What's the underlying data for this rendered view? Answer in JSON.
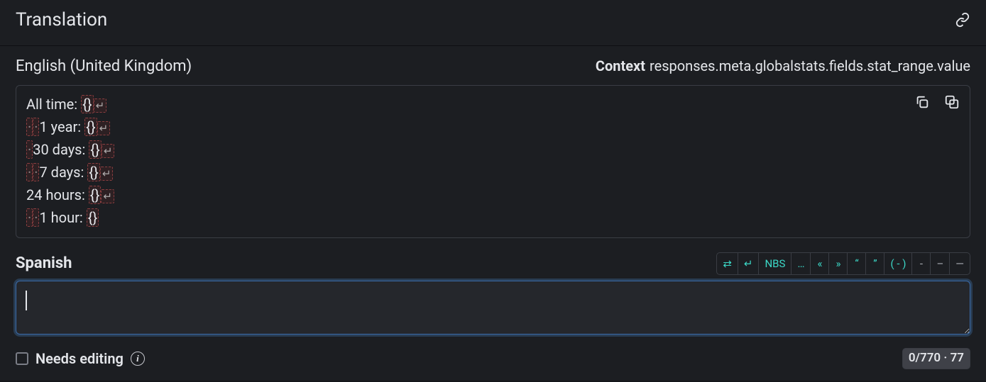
{
  "header": {
    "title": "Translation"
  },
  "source": {
    "lang_label": "English (United Kingdom)",
    "context_label": "Context",
    "context_value": "responses.meta.globalstats.fields.stat_range.value",
    "lines": [
      {
        "leading_spaces": 0,
        "text": "All time: ",
        "placeholder": "{}",
        "newline": true
      },
      {
        "leading_spaces": 2,
        "text": "1 year: ",
        "placeholder": "{}",
        "newline": true
      },
      {
        "leading_spaces": 1,
        "text": "30 days: ",
        "placeholder": "{}",
        "newline": true
      },
      {
        "leading_spaces": 2,
        "text": "7 days: ",
        "placeholder": "{}",
        "newline": true
      },
      {
        "leading_spaces": 0,
        "text": "24 hours: ",
        "placeholder": "{}",
        "newline": true
      },
      {
        "leading_spaces": 2,
        "text": "1 hour: ",
        "placeholder": "{}",
        "newline": false
      }
    ]
  },
  "target": {
    "lang_label": "Spanish",
    "value": "",
    "placeholder": ""
  },
  "toolbar": [
    {
      "id": "toggle-direction",
      "label": "⇄",
      "muted": false
    },
    {
      "id": "insert-newline",
      "label": "↵",
      "muted": false
    },
    {
      "id": "insert-nbs",
      "label": "NBS",
      "muted": false
    },
    {
      "id": "insert-ellipsis",
      "label": "…",
      "muted": false
    },
    {
      "id": "insert-laquo",
      "label": "«",
      "muted": false
    },
    {
      "id": "insert-raquo",
      "label": "»",
      "muted": false
    },
    {
      "id": "insert-ldquo",
      "label": "“",
      "muted": false
    },
    {
      "id": "insert-rdquo",
      "label": "”",
      "muted": false
    },
    {
      "id": "insert-parens",
      "label": "(  -  )",
      "muted": false
    },
    {
      "id": "insert-hyphen",
      "label": "-",
      "muted": true
    },
    {
      "id": "insert-endash",
      "label": "–",
      "muted": true
    },
    {
      "id": "insert-emdash",
      "label": "—",
      "muted": true
    }
  ],
  "footer": {
    "needs_editing_label": "Needs editing",
    "needs_editing_checked": false,
    "counter": "0/770 · 77"
  }
}
